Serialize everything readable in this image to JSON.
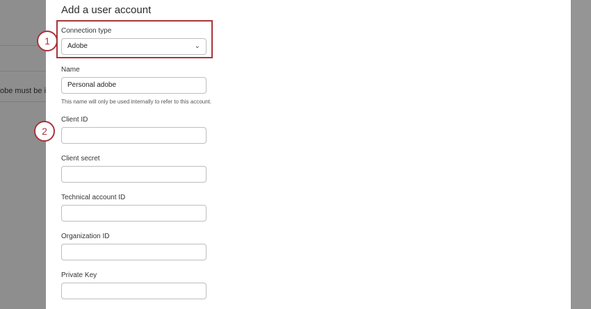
{
  "background": {
    "left_snippet": "obe must be in"
  },
  "modal": {
    "title": "Add a user account",
    "connection_type": {
      "label": "Connection type",
      "value": "Adobe"
    },
    "name": {
      "label": "Name",
      "value": "Personal adobe",
      "help": "This name will only be used internally to refer to this account."
    },
    "client_id": {
      "label": "Client ID",
      "value": ""
    },
    "client_secret": {
      "label": "Client secret",
      "value": ""
    },
    "technical_account_id": {
      "label": "Technical account ID",
      "value": ""
    },
    "organization_id": {
      "label": "Organization ID",
      "value": ""
    },
    "private_key": {
      "label": "Private Key",
      "value": ""
    }
  },
  "callouts": [
    "1",
    "2"
  ],
  "colors": {
    "accent": "#a8343a",
    "overlay": "#8f8f8f"
  }
}
